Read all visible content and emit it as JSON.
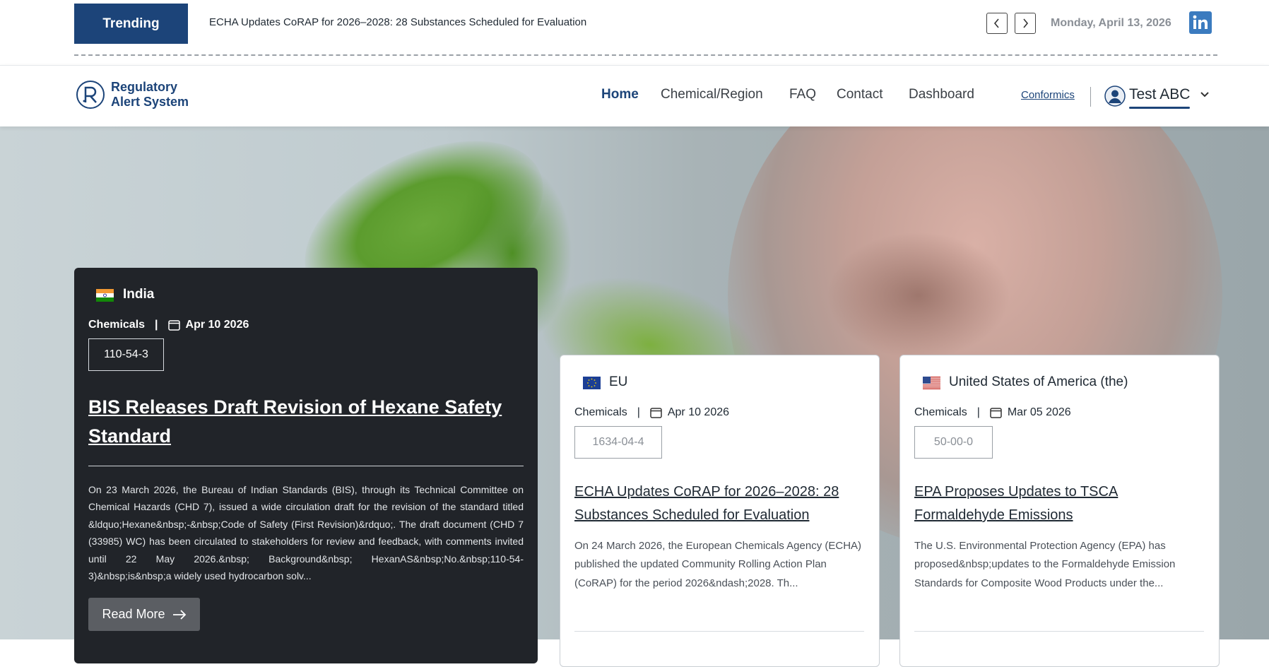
{
  "topbar": {
    "trending_label": "Trending",
    "ticker_text": "ECHA Updates CoRAP for 2026–2028: 28 Substances Scheduled for Evaluation",
    "date": "Monday, April 13, 2026",
    "linkedin_icon": "linkedin-icon"
  },
  "nav": {
    "logo_line1": "Regulatory",
    "logo_line2": "Alert System",
    "links": [
      {
        "label": "Home",
        "active": true
      },
      {
        "label": "Chemical/Region",
        "active": false
      },
      {
        "label": "FAQ",
        "active": false
      },
      {
        "label": "Contact",
        "active": false
      },
      {
        "label": "Dashboard",
        "active": false
      }
    ],
    "conformics_label": "Conformics",
    "user_name": "Test ABC"
  },
  "cards": {
    "featured": {
      "country": "India",
      "category": "Chemicals",
      "separator": "|",
      "date": "Apr 10 2026",
      "cas": "110-54-3",
      "title": "BIS Releases Draft Revision of Hexane Safety Standard",
      "description": "On 23 March 2026, the Bureau of Indian Standards (BIS), through its Technical Committee on Chemical Hazards (CHD 7), issued a wide circulation draft for the revision of the standard titled &ldquo;Hexane&nbsp;-&nbsp;Code of Safety (First Revision)&rdquo;. The draft document (CHD 7 (33985) WC) has been circulated to stakeholders for review and feedback, with comments invited until 22 May 2026.&nbsp; Background&nbsp; HexanAS&nbsp;No.&nbsp;110-54-3)&nbsp;is&nbsp;a widely used hydrocarbon solv...",
      "read_more": "Read More"
    },
    "eu": {
      "country": "EU",
      "category": "Chemicals",
      "separator": "|",
      "date": "Apr 10 2026",
      "cas": "1634-04-4",
      "title": "ECHA Updates CoRAP for 2026–2028: 28 Substances Scheduled for Evaluation",
      "description": "On 24 March 2026, the European Chemicals Agency (ECHA) published the updated Community Rolling Action Plan (CoRAP) for the period 2026&ndash;2028. Th..."
    },
    "us": {
      "country": "United States of America (the)",
      "category": "Chemicals",
      "separator": "|",
      "date": "Mar 05 2026",
      "cas": "50-00-0",
      "title": "EPA Proposes Updates to TSCA Formaldehyde Emissions",
      "description": "The U.S. Environmental Protection Agency (EPA) has proposed&nbsp;updates to the Formaldehyde Emission Standards for Composite Wood Products under the..."
    }
  },
  "colors": {
    "brand": "#1c4479",
    "card_dark": "#212429",
    "button_gray": "#5b5e63"
  }
}
